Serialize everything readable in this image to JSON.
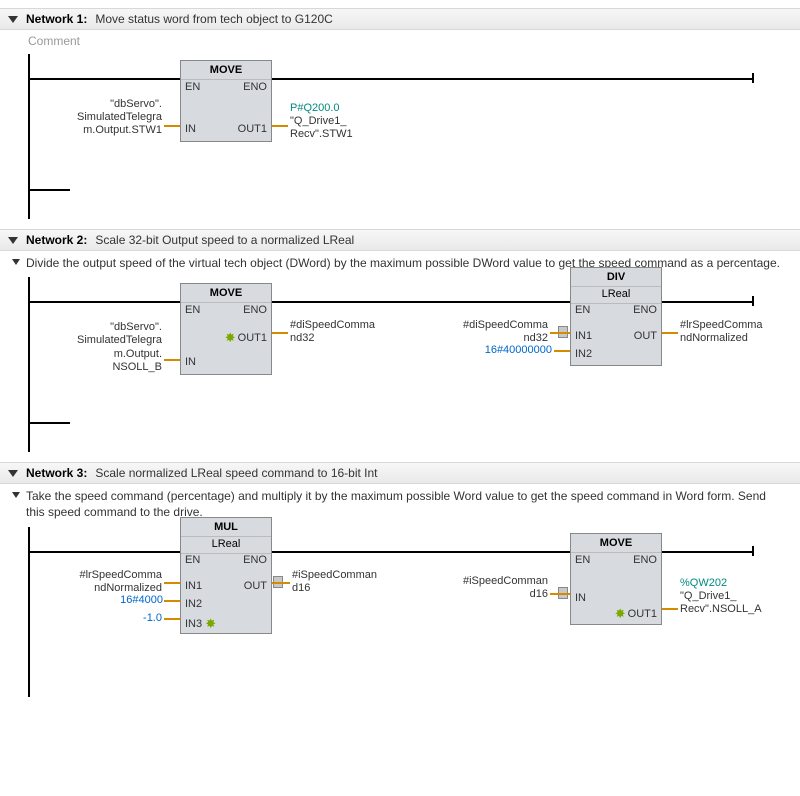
{
  "networks": [
    {
      "label": "Network 1:",
      "title": "Move status word from tech object to G120C",
      "comment": "Comment",
      "comment_is_placeholder": true,
      "blocks": {
        "move": {
          "title": "MOVE",
          "en": "EN",
          "eno": "ENO",
          "in": "IN",
          "out1": "OUT1"
        }
      },
      "tags": {
        "in": "\"dbServo\".\nSimulatedTelegra\nm.Output.STW1",
        "out_addr": "P#Q200.0",
        "out": "\"Q_Drive1_\nRecv\".STW1"
      }
    },
    {
      "label": "Network 2:",
      "title": "Scale 32-bit Output speed to a normalized LReal",
      "comment": "Divide the output speed of the virtual tech object (DWord) by the maximum possible DWord value to get the speed command as a percentage.",
      "comment_is_placeholder": false,
      "blocks": {
        "move": {
          "title": "MOVE",
          "en": "EN",
          "eno": "ENO",
          "in": "IN",
          "out1": "OUT1"
        },
        "div": {
          "title": "DIV",
          "subtitle": "LReal",
          "en": "EN",
          "eno": "ENO",
          "in1": "IN1",
          "in2": "IN2",
          "out": "OUT"
        }
      },
      "tags": {
        "move_in": "\"dbServo\".\nSimulatedTelegra\nm.Output.\nNSOLL_B",
        "move_out": "#diSpeedComma\nnd32",
        "div_in1": "#diSpeedComma\nnd32",
        "div_in2": "16#40000000",
        "div_out": "#lrSpeedComma\nndNormalized"
      }
    },
    {
      "label": "Network 3:",
      "title": "Scale normalized LReal speed command to 16-bit Int",
      "comment": "Take the speed command (percentage) and multiply it by the maximum possible Word value to get the speed command in Word form. Send this speed command to the drive.",
      "comment_is_placeholder": false,
      "blocks": {
        "mul": {
          "title": "MUL",
          "subtitle": "LReal",
          "en": "EN",
          "eno": "ENO",
          "in1": "IN1",
          "in2": "IN2",
          "in3": "IN3",
          "out": "OUT"
        },
        "move": {
          "title": "MOVE",
          "en": "EN",
          "eno": "ENO",
          "in": "IN",
          "out1": "OUT1"
        }
      },
      "tags": {
        "mul_in1": "#lrSpeedComma\nndNormalized",
        "mul_in2": "16#4000",
        "mul_in3": "-1.0",
        "mul_out": "#iSpeedComman\nd16",
        "move_in": "#iSpeedComman\nd16",
        "move_out_addr": "%QW202",
        "move_out": "\"Q_Drive1_\nRecv\".NSOLL_A"
      }
    }
  ]
}
